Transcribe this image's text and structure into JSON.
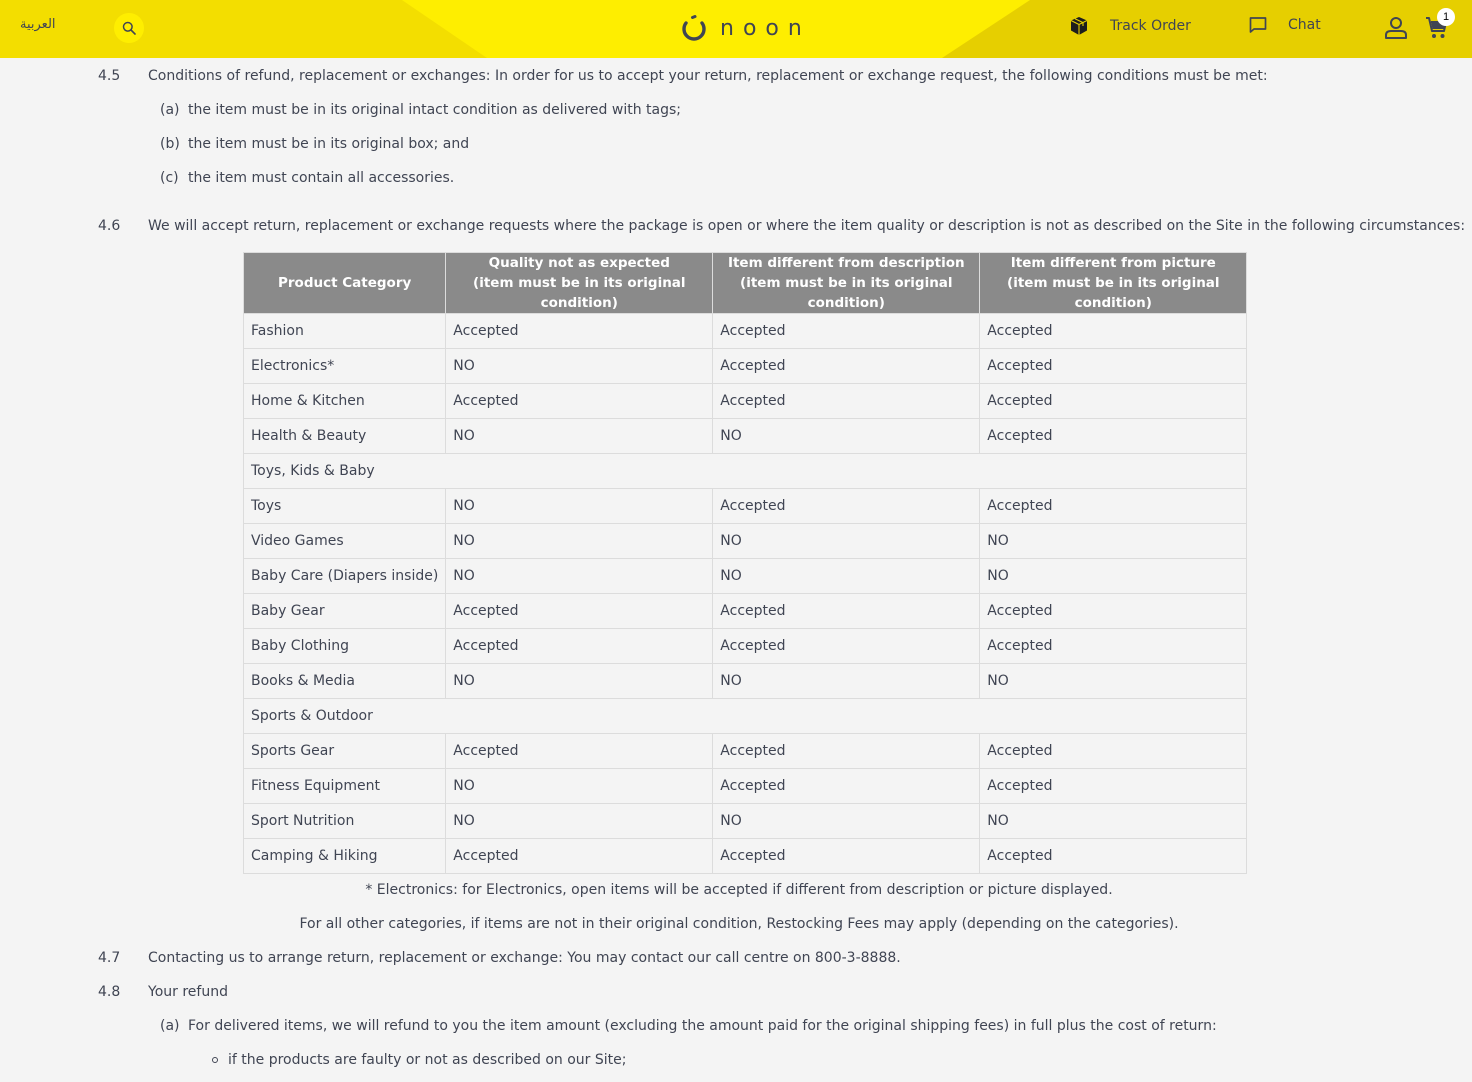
{
  "header": {
    "language_link": "العربية",
    "logo_text": "noon",
    "track_order_label": "Track Order",
    "chat_label": "Chat",
    "cart_count": "1",
    "colors": {
      "brand_yellow": "#feee00",
      "left_band": "#f3de00",
      "right_band": "#e6cf00",
      "text": "#404553"
    }
  },
  "sections": {
    "s45": {
      "number": "4.5",
      "text": "Conditions of refund, replacement or exchanges: In order for us to accept your return, replacement or exchange request, the following conditions must be met:",
      "items": [
        {
          "label": "(a)",
          "text": "the item must be in its original intact condition as delivered with tags;"
        },
        {
          "label": "(b)",
          "text": "the item must be in its original box; and"
        },
        {
          "label": "(c)",
          "text": "the item must contain all accessories."
        }
      ]
    },
    "s46": {
      "number": "4.6",
      "text": "We will accept return, replacement or exchange requests where the package is open or where the item quality or description is not as described on the Site in the following circumstances:"
    },
    "s47": {
      "number": "4.7",
      "text": "Contacting us to arrange return, replacement or exchange: You may contact our call centre on 800-3-8888."
    },
    "s48": {
      "number": "4.8",
      "text": "Your refund",
      "items": [
        {
          "label": "(a)",
          "text": "For delivered items, we will refund to you the item amount (excluding the amount paid for the original shipping fees) in full plus the cost of return:"
        }
      ],
      "bullets": [
        "if the products are faulty or not as described on our Site;"
      ]
    }
  },
  "table": {
    "headers": [
      {
        "line1": "Product Category",
        "line2": ""
      },
      {
        "line1": "Quality not as expected",
        "line2": "(item must be in its original condition)"
      },
      {
        "line1": "Item different from description",
        "line2": "(item must be in its original condition)"
      },
      {
        "line1": "Item different from picture",
        "line2": "(item must be in its original condition)"
      }
    ],
    "rows": [
      {
        "category": "Fashion",
        "quality": "Accepted",
        "description": "Accepted",
        "picture": "Accepted"
      },
      {
        "category": "Electronics*",
        "quality": "NO",
        "description": "Accepted",
        "picture": "Accepted"
      },
      {
        "category": "Home & Kitchen",
        "quality": "Accepted",
        "description": "Accepted",
        "picture": "Accepted"
      },
      {
        "category": "Health & Beauty",
        "quality": "NO",
        "description": "NO",
        "picture": "Accepted"
      },
      {
        "category": "Toys, Kids & Baby",
        "group": true
      },
      {
        "category": "Toys",
        "quality": "NO",
        "description": "Accepted",
        "picture": "Accepted"
      },
      {
        "category": "Video Games",
        "quality": "NO",
        "description": "NO",
        "picture": "NO"
      },
      {
        "category": "Baby Care (Diapers inside)",
        "quality": "NO",
        "description": "NO",
        "picture": "NO"
      },
      {
        "category": "Baby Gear",
        "quality": "Accepted",
        "description": "Accepted",
        "picture": "Accepted"
      },
      {
        "category": "Baby Clothing",
        "quality": "Accepted",
        "description": "Accepted",
        "picture": "Accepted"
      },
      {
        "category": "Books & Media",
        "quality": "NO",
        "description": "NO",
        "picture": "NO"
      },
      {
        "category": "Sports & Outdoor",
        "group": true
      },
      {
        "category": "Sports Gear",
        "quality": "Accepted",
        "description": "Accepted",
        "picture": "Accepted"
      },
      {
        "category": "Fitness Equipment",
        "quality": "NO",
        "description": "Accepted",
        "picture": "Accepted"
      },
      {
        "category": "Sport Nutrition",
        "quality": "NO",
        "description": "NO",
        "picture": "NO"
      },
      {
        "category": "Camping & Hiking",
        "quality": "Accepted",
        "description": "Accepted",
        "picture": "Accepted"
      }
    ],
    "header_bg": "#8a8a8a"
  },
  "notes": {
    "electronics": "* Electronics: for Electronics, open items will be accepted if different from description or picture displayed.",
    "restocking": "For all other categories, if items are not in their original condition, Restocking Fees may apply (depending on the categories)."
  }
}
